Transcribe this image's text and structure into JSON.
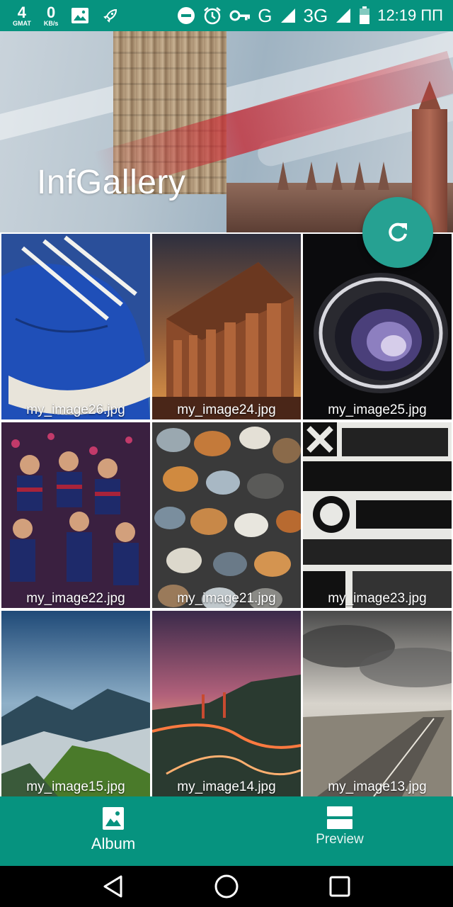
{
  "status_bar": {
    "sim_number": "4",
    "sim_label": "GMAT",
    "net_speed_value": "0",
    "net_speed_unit": "KB/s",
    "network_g": "G",
    "network_3g": "3G",
    "time": "12:19 ПП",
    "icons": [
      "image-icon",
      "rocket-icon",
      "do-not-disturb-icon",
      "alarm-icon",
      "vpn-key-icon",
      "signal-icon",
      "battery-icon"
    ]
  },
  "header": {
    "title": "InfGallery"
  },
  "fab": {
    "icon": "refresh-icon",
    "color": "#26a192"
  },
  "grid": {
    "items": [
      {
        "label": "my_image26.jpg"
      },
      {
        "label": "my_image24.jpg"
      },
      {
        "label": "my_image25.jpg"
      },
      {
        "label": "my_image22.jpg"
      },
      {
        "label": "my_image21.jpg"
      },
      {
        "label": "my_image23.jpg"
      },
      {
        "label": "my_image15.jpg"
      },
      {
        "label": "my_image14.jpg"
      },
      {
        "label": "my_image13.jpg"
      }
    ]
  },
  "bottom_nav": {
    "album_label": "Album",
    "preview_label": "Preview",
    "album_icon": "photo-album-icon",
    "preview_icon": "view-stream-icon",
    "background": "#06937f"
  },
  "system_nav": {
    "icons": [
      "back-icon",
      "home-icon",
      "recents-icon"
    ]
  },
  "colors": {
    "primary": "#06937f",
    "accent": "#26a192"
  }
}
